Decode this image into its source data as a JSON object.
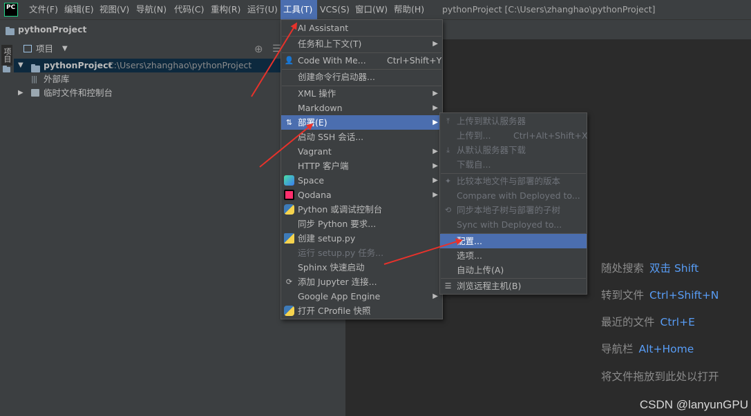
{
  "menubar": {
    "logo": "PC",
    "items": [
      "文件(F)",
      "编辑(E)",
      "视图(V)",
      "导航(N)",
      "代码(C)",
      "重构(R)",
      "运行(U)",
      "工具(T)",
      "VCS(S)",
      "窗口(W)",
      "帮助(H)"
    ],
    "window_title": "pythonProject [C:\\Users\\zhanghao\\pythonProject]"
  },
  "navbar": {
    "project": "pythonProject"
  },
  "stripe": {
    "tab": "项目"
  },
  "project_panel": {
    "dropdown": "项目",
    "tree": {
      "root_name": "pythonProject",
      "root_path": "C:\\Users\\zhanghao\\pythonProject",
      "external_libs": "外部库",
      "scratches": "临时文件和控制台"
    }
  },
  "tools_menu": {
    "items": [
      {
        "label": "AI Assistant"
      },
      {
        "label": "任务和上下文(T)",
        "submenu": true
      },
      {
        "label": "Code With Me...",
        "shortcut": "Ctrl+Shift+Y",
        "icon": "code-with-me-icon"
      },
      {
        "label": "创建命令行启动器..."
      },
      {
        "label": "XML 操作",
        "submenu": true
      },
      {
        "label": "Markdown",
        "submenu": true
      },
      {
        "label": "部署(E)",
        "submenu": true,
        "icon": "deployment-icon",
        "highlighted": true
      },
      {
        "label": "启动 SSH 会话..."
      },
      {
        "label": "Vagrant",
        "submenu": true
      },
      {
        "label": "HTTP 客户端",
        "submenu": true
      },
      {
        "label": "Space",
        "submenu": true,
        "icon": "space-icon"
      },
      {
        "label": "Qodana",
        "submenu": true,
        "icon": "qodana-icon"
      },
      {
        "label": "Python 或调试控制台",
        "icon": "python-icon"
      },
      {
        "label": "同步 Python 要求..."
      },
      {
        "label": "创建 setup.py",
        "icon": "setup-py-icon"
      },
      {
        "label": "运行 setup.py 任务...",
        "disabled": true
      },
      {
        "label": "Sphinx 快速启动"
      },
      {
        "label": "添加 Jupyter 连接...",
        "icon": "jupyter-icon"
      },
      {
        "label": "Google App Engine",
        "submenu": true
      },
      {
        "label": "打开 CProfile 快照",
        "icon": "python-profile-icon"
      }
    ]
  },
  "deploy_menu": {
    "items": [
      {
        "label": "上传到默认服务器",
        "disabled": true,
        "icon": "upload-icon"
      },
      {
        "label": "上传到...",
        "shortcut": "Ctrl+Alt+Shift+X",
        "disabled": true
      },
      {
        "label": "从默认服务器下载",
        "disabled": true,
        "icon": "download-icon"
      },
      {
        "label": "下载自...",
        "disabled": true
      },
      {
        "label": "比较本地文件与部署的版本",
        "disabled": true,
        "icon": "compare-icon"
      },
      {
        "label": "Compare with Deployed to...",
        "disabled": true
      },
      {
        "label": "同步本地子树与部署的子树",
        "disabled": true,
        "icon": "sync-icon"
      },
      {
        "label": "Sync with Deployed to...",
        "disabled": true
      },
      {
        "label": "配置...",
        "highlighted": true
      },
      {
        "label": "选项..."
      },
      {
        "label": "自动上传(A)"
      },
      {
        "label": "浏览远程主机(B)",
        "icon": "remote-host-icon"
      }
    ]
  },
  "editor_hints": [
    {
      "text": "随处搜索",
      "key": "双击 Shift"
    },
    {
      "text": "转到文件",
      "key": "Ctrl+Shift+N"
    },
    {
      "text": "最近的文件",
      "key": "Ctrl+E"
    },
    {
      "text": "导航栏",
      "key": "Alt+Home"
    },
    {
      "text": "将文件拖放到此处以打开",
      "key": ""
    }
  ],
  "watermark": "CSDN @lanyunGPU",
  "colors": {
    "accent": "#4b6eaf",
    "arrow": "#e8322b",
    "hint_key": "#589df6"
  }
}
